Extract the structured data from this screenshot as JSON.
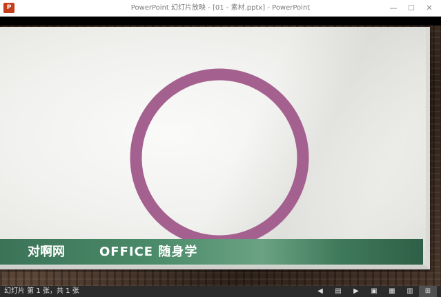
{
  "window": {
    "title": "PowerPoint 幻灯片放映 - [01 - 素材.pptx] - PowerPoint",
    "app_icon_label": "P",
    "controls": {
      "minimize": "—",
      "restore": "☐",
      "close": "✕"
    }
  },
  "slide": {
    "circle_color": "#a4608f",
    "banner_color": "#3b7357",
    "banner_left": "对啊网",
    "banner_right": "OFFICE 随身学"
  },
  "status": {
    "text": "幻灯片 第 1 张，共 1 张",
    "icons": {
      "prev": "◀",
      "menu": "▤",
      "next": "▶",
      "normal": "▣",
      "sorter": "▦",
      "reading": "▥",
      "slideshow": "⊞"
    }
  }
}
